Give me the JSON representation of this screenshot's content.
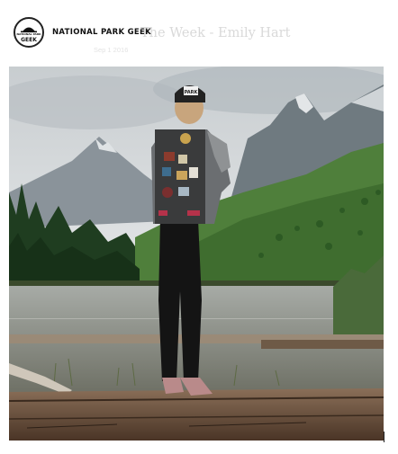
{
  "header": {
    "logo": {
      "name": "NATIONAL PARK GEEK",
      "badge_text_top": "NATIONAL PARK",
      "badge_text_bottom": "GEEK"
    },
    "ghost_title": "The Week - Emily Hart",
    "ghost_subtitle": "Sep 1 2016"
  },
  "hero_image": {
    "cap_patch_text": "PARK",
    "colors": {
      "sky": "#d7dadc",
      "mountains": "#7b858c",
      "forest": "#2f5a2c",
      "lake": "#8c8f86",
      "log": "#6b5340",
      "jacket_pack": "#3a3b3c",
      "leggings": "#141414"
    }
  }
}
